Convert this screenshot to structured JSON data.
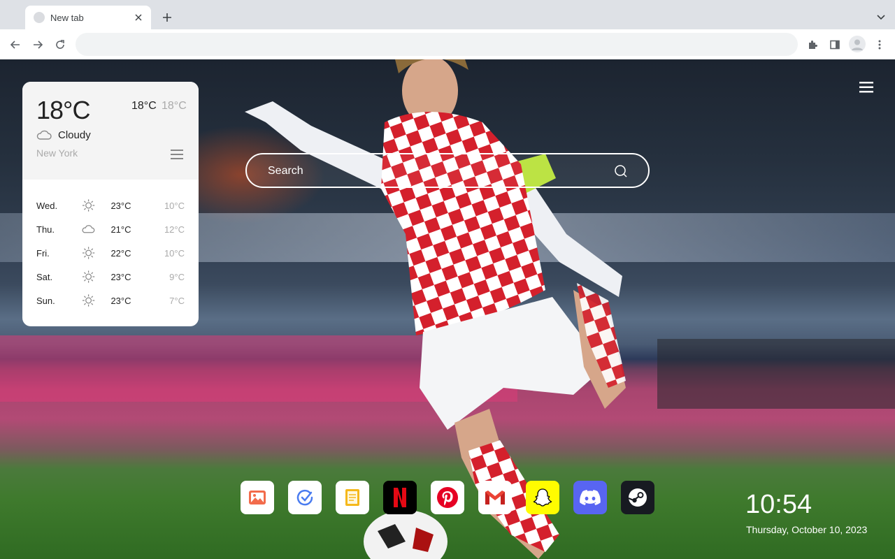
{
  "browser": {
    "tab_title": "New tab",
    "omnibox_value": "",
    "icons": [
      "favicon-icon",
      "close-icon",
      "plus-icon",
      "chevron-down-icon",
      "back-icon",
      "forward-icon",
      "reload-icon",
      "extensions-icon",
      "side-panel-icon",
      "profile-icon",
      "more-vert-icon"
    ]
  },
  "weather": {
    "current_temp": "18°C",
    "high": "18°C",
    "low": "18°C",
    "condition": "Cloudy",
    "city": "New York",
    "forecast": [
      {
        "day": "Wed.",
        "icon": "sun-icon",
        "high": "23°C",
        "low": "10°C"
      },
      {
        "day": "Thu.",
        "icon": "cloud-icon",
        "high": "21°C",
        "low": "12°C"
      },
      {
        "day": "Fri.",
        "icon": "sun-icon",
        "high": "22°C",
        "low": "10°C"
      },
      {
        "day": "Sat.",
        "icon": "sun-icon",
        "high": "23°C",
        "low": "9°C"
      },
      {
        "day": "Sun.",
        "icon": "sun-icon",
        "high": "23°C",
        "low": "7°C"
      }
    ]
  },
  "search": {
    "placeholder": "Search"
  },
  "shortcuts": [
    {
      "name": "gallery",
      "icon": "image-icon",
      "bg": "#ffffff"
    },
    {
      "name": "tasks",
      "icon": "check-circle-icon",
      "bg": "#ffffff"
    },
    {
      "name": "notes",
      "icon": "notes-icon",
      "bg": "#ffffff"
    },
    {
      "name": "netflix",
      "icon": "netflix-icon",
      "bg": "#000000"
    },
    {
      "name": "pinterest",
      "icon": "pinterest-icon",
      "bg": "#ffffff"
    },
    {
      "name": "gmail",
      "icon": "gmail-icon",
      "bg": "#ffffff"
    },
    {
      "name": "snapchat",
      "icon": "snapchat-icon",
      "bg": "#fffc00"
    },
    {
      "name": "discord",
      "icon": "discord-icon",
      "bg": "#5865f2"
    },
    {
      "name": "steam",
      "icon": "steam-icon",
      "bg": "#171a21"
    }
  ],
  "clock": {
    "time": "10:54",
    "date": "Thursday, October 10, 2023"
  },
  "colors": {
    "chrome_bg": "#dee1e6",
    "netflix_red": "#e50914",
    "pinterest_red": "#e60023",
    "gmail_red": "#ea4335",
    "discord": "#5865f2",
    "snapchat": "#fffc00"
  }
}
